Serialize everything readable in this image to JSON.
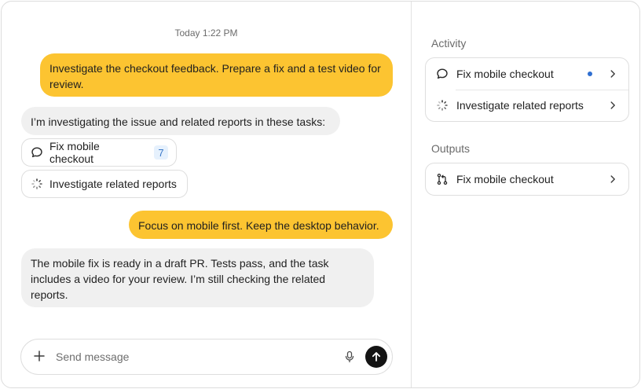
{
  "chat": {
    "timestamp": "Today 1:22 PM",
    "messages": [
      {
        "role": "user",
        "text": "Investigate the checkout feedback. Prepare a fix and a test video for review."
      },
      {
        "role": "assistant",
        "text": "I’m investigating the issue and related reports in these tasks:"
      },
      {
        "role": "user",
        "text": "Focus on mobile first. Keep the desktop behavior."
      },
      {
        "role": "assistant",
        "text": "The mobile fix is ready in a draft PR. Tests pass, and the task includes a video for your review. I’m still checking the related reports."
      }
    ],
    "tasks": [
      {
        "label": "Fix mobile checkout",
        "icon": "chat-bubble-icon",
        "badge": "7"
      },
      {
        "label": "Investigate related reports",
        "icon": "loading-spinner-icon"
      }
    ],
    "composer": {
      "placeholder": "Send message",
      "value": ""
    }
  },
  "sidebar": {
    "activity_title": "Activity",
    "activity_items": [
      {
        "label": "Fix mobile checkout",
        "icon": "chat-bubble-icon",
        "unread": true
      },
      {
        "label": "Investigate related reports",
        "icon": "loading-spinner-icon",
        "unread": false
      }
    ],
    "outputs_title": "Outputs",
    "output_items": [
      {
        "label": "Fix mobile checkout",
        "icon": "pull-request-icon"
      }
    ]
  },
  "colors": {
    "user_bubble": "#fcc431",
    "assistant_bubble": "#f0f0f0",
    "unread_dot": "#2f6fd1",
    "badge_bg": "#e6f1fd",
    "badge_text": "#3a78c8"
  }
}
